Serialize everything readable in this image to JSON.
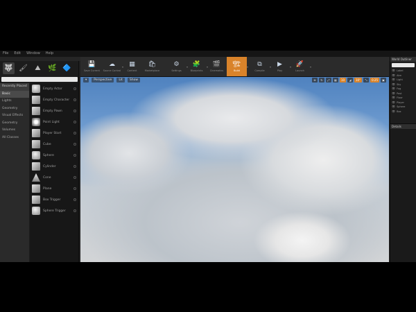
{
  "menu": [
    "File",
    "Edit",
    "Window",
    "Help"
  ],
  "modes": {
    "icons": [
      {
        "name": "place-mode-icon",
        "glyph": "🐺",
        "active": true
      },
      {
        "name": "paint-mode-icon",
        "glyph": "🖌"
      },
      {
        "name": "landscape-mode-icon",
        "glyph": "⛰"
      },
      {
        "name": "foliage-mode-icon",
        "glyph": "🌿"
      },
      {
        "name": "geometry-mode-icon",
        "glyph": "🔷"
      }
    ],
    "search_placeholder": "Search Classes",
    "categories": [
      "Recently Placed",
      "Basic",
      "Lights",
      "Geometry",
      "Visual Effects",
      "Geometry",
      "Volumes",
      "All Classes"
    ],
    "places": [
      {
        "label": "Empty Actor",
        "shape": "sphere"
      },
      {
        "label": "Empty Character",
        "shape": "cube"
      },
      {
        "label": "Empty Pawn",
        "shape": "cube"
      },
      {
        "label": "Point Light",
        "shape": "light"
      },
      {
        "label": "Player Start",
        "shape": "cube"
      },
      {
        "label": "Cube",
        "shape": "cube"
      },
      {
        "label": "Sphere",
        "shape": "sphere"
      },
      {
        "label": "Cylinder",
        "shape": "cube"
      },
      {
        "label": "Cone",
        "shape": "cone"
      },
      {
        "label": "Plane",
        "shape": "cube"
      },
      {
        "label": "Box Trigger",
        "shape": "cube"
      },
      {
        "label": "Sphere Trigger",
        "shape": "sphere"
      }
    ]
  },
  "toolbar": [
    {
      "name": "save-current-button",
      "glyph": "💾",
      "label": "Save Current"
    },
    {
      "name": "source-control-button",
      "glyph": "☁",
      "label": "Source Control"
    },
    {
      "name": "content-button",
      "glyph": "▦",
      "label": "Content"
    },
    {
      "name": "marketplace-button",
      "glyph": "🛍",
      "label": "Marketplace"
    },
    {
      "name": "settings-button",
      "glyph": "⚙",
      "label": "Settings"
    },
    {
      "name": "blueprints-button",
      "glyph": "🧩",
      "label": "Blueprints"
    },
    {
      "name": "cinematics-button",
      "glyph": "🎬",
      "label": "Cinematics"
    },
    {
      "name": "build-button",
      "glyph": "🏗",
      "label": "Build",
      "active": true
    },
    {
      "name": "compile-button",
      "glyph": "⧉",
      "label": "Compile"
    },
    {
      "name": "play-button",
      "glyph": "▶",
      "label": "Play"
    },
    {
      "name": "launch-button",
      "glyph": "🚀",
      "label": "Launch"
    }
  ],
  "viewport": {
    "left_buttons": [
      "Perspective",
      "Lit",
      "Show"
    ],
    "right_chips": [
      "⊕",
      "↻",
      "⤢",
      "▦",
      "10",
      "◢",
      "10°",
      "⤡",
      "0.25",
      "▣"
    ]
  },
  "outliner": {
    "title": "World Outliner",
    "rows": [
      "Label",
      "Atm",
      "Light",
      "Sky",
      "Fog",
      "Post",
      "Floor",
      "Player",
      "Sphere",
      "Box"
    ]
  },
  "details": {
    "title": "Details"
  }
}
